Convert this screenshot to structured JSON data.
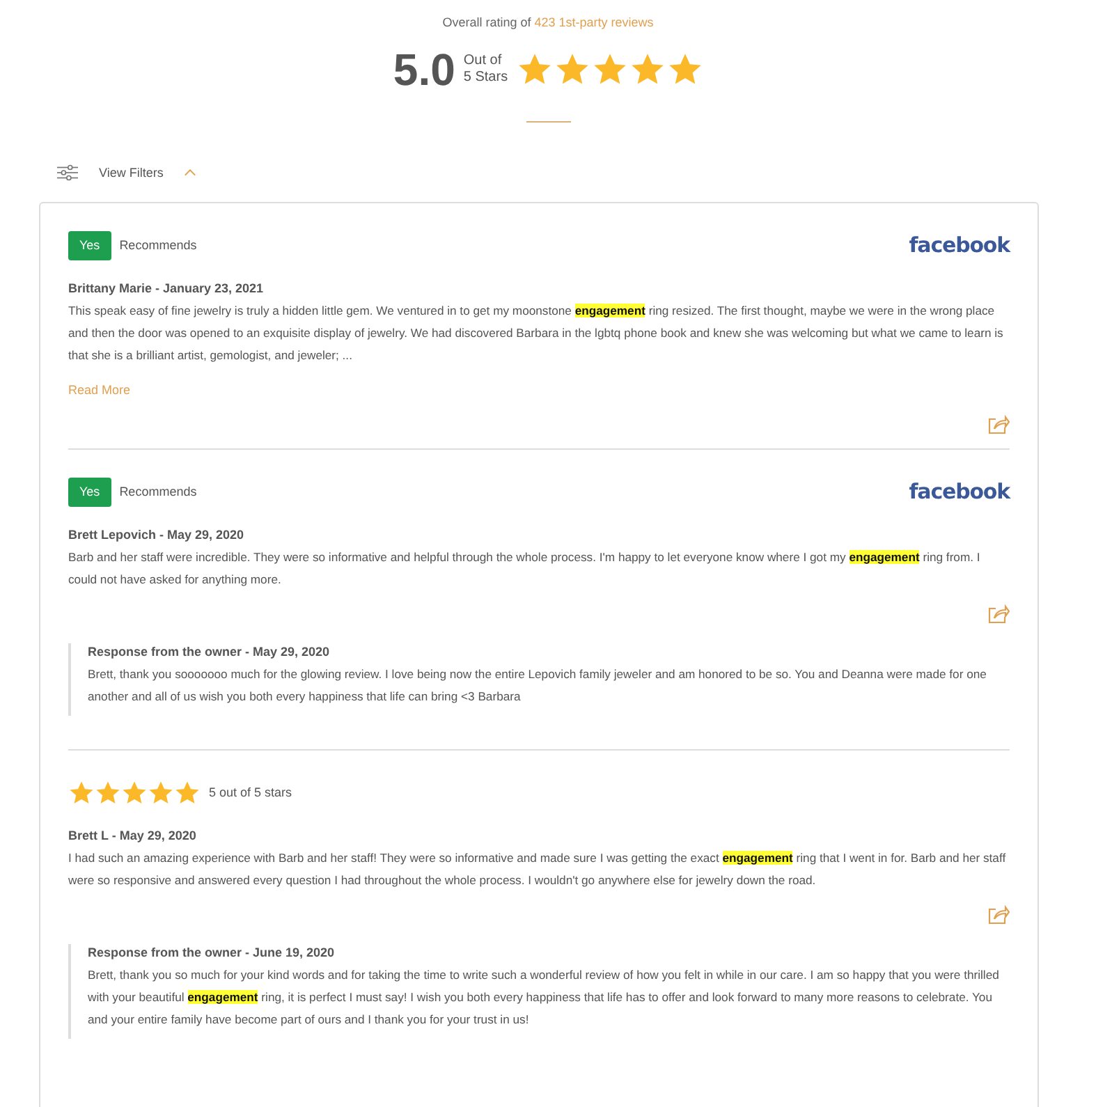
{
  "summary": {
    "prefix": "Overall rating of",
    "link": "423 1st-party reviews",
    "score": "5.0",
    "out_of": "Out of",
    "scale": "5 Stars",
    "stars": 5
  },
  "filters": {
    "label": "View Filters",
    "expanded": true
  },
  "reviews": [
    {
      "kind": "recommend",
      "badge": "Yes",
      "badge_label": "Recommends",
      "source": "facebook",
      "author": "Brittany Marie - January 23, 2021",
      "text": "This speak easy of fine jewelry is truly a hidden little gem. We ventured in to get my moonstone **engagement** ring resized. The first thought, maybe we were in the wrong place and then the door was opened to an exquisite display of jewelry. We had discovered Barbara in the lgbtq phone book and knew she was welcoming but what we came to learn is that she is a brilliant artist, gemologist, and jeweler; ...",
      "read_more": "Read More"
    },
    {
      "kind": "recommend",
      "badge": "Yes",
      "badge_label": "Recommends",
      "source": "facebook",
      "author": "Brett Lepovich - May 29, 2020",
      "text": "Barb and her staff were incredible. They were so informative and helpful through the whole process. I'm happy to let everyone know where I got my **engagement** ring from. I could not have asked for anything more.",
      "response": {
        "title": "Response from the owner - May 29, 2020",
        "text": "Brett, thank you sooooooo much for the glowing review. I love being now the entire Lepovich family jeweler and am honored to be so. You and Deanna were made for one another and all of us wish you both every happiness that life can bring <3 Barbara"
      }
    },
    {
      "kind": "stars",
      "stars": 5,
      "rating_label": "5 out of 5 stars",
      "author": "Brett L - May 29, 2020",
      "text": "I had such an amazing experience with Barb and her staff! They were so informative and made sure I was getting the exact **engagement** ring that I went in for. Barb and her staff were so responsive and answered every question I had throughout the whole process. I wouldn't go anywhere else for jewelry down the road.",
      "response": {
        "title": "Response from the owner - June 19, 2020",
        "text": "Brett, thank you so much for your kind words and for taking the time to write such a wonderful review of how you felt in while in our care. I am so happy that you were thrilled with your beautiful **engagement** ring, it is perfect I must say! I wish you both every happiness that life has to offer and look forward to many more reasons to celebrate. You and your entire family have become part of ours and I thank you for your trust in us!"
      }
    }
  ]
}
